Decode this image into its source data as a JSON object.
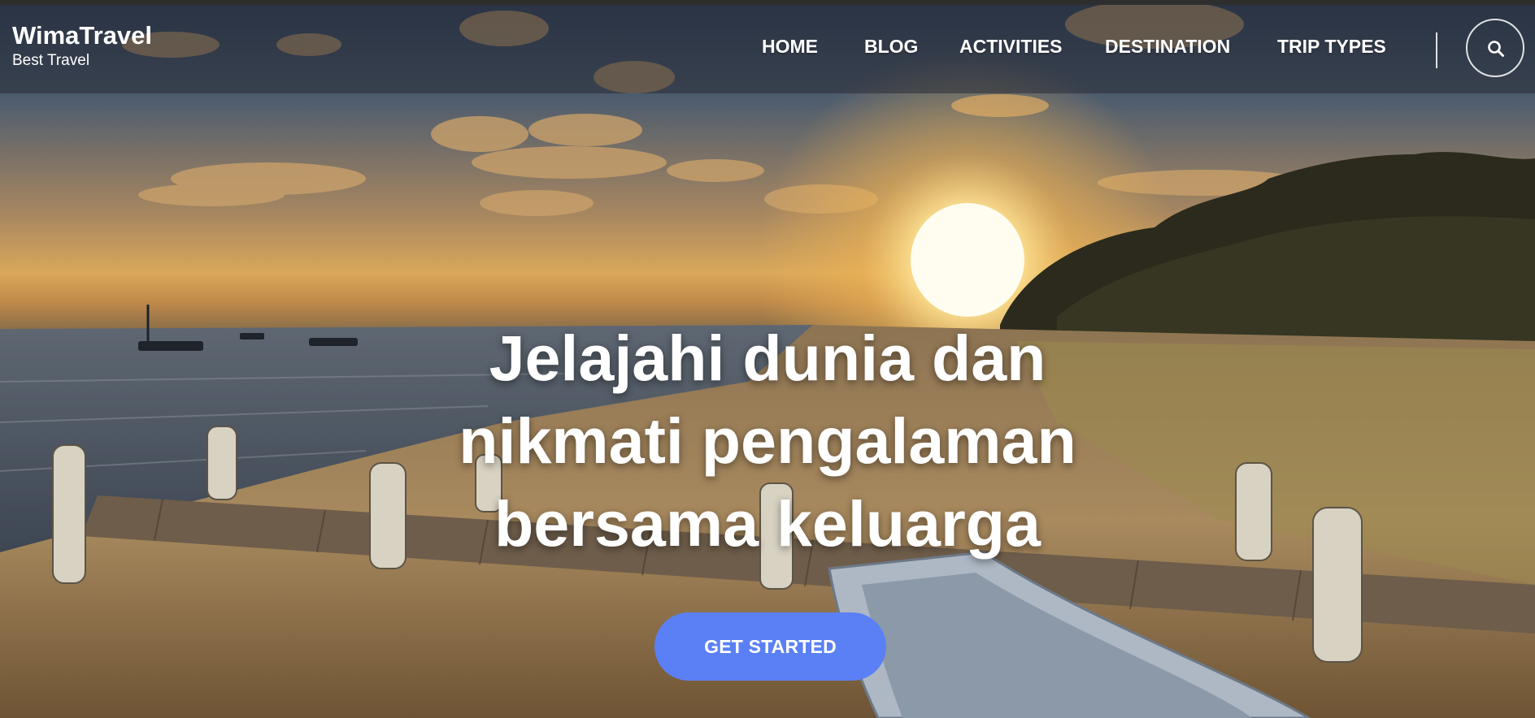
{
  "brand": {
    "title": "WimaTravel",
    "subtitle": "Best Travel"
  },
  "nav": {
    "items": [
      "HOME",
      "BLOG",
      "ACTIVITIES",
      "DESTINATION",
      "TRIP TYPES"
    ]
  },
  "search": {
    "icon": "search-icon"
  },
  "hero": {
    "headline": [
      "Jelajahi dunia dan",
      "nikmati pengalaman",
      "bersama keluarga"
    ],
    "cta_label": "GET STARTED"
  },
  "colors": {
    "accent": "#5b80f5",
    "navbar": "#282c34",
    "text": "#ffffff"
  }
}
